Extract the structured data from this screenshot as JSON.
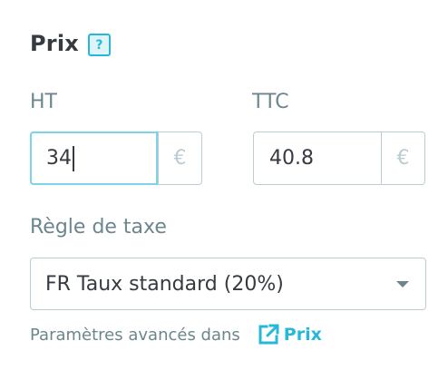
{
  "section": {
    "title": "Prix",
    "help_icon": "help-question-icon",
    "help_glyph": "?"
  },
  "price_excl_tax": {
    "label": "HT",
    "value": "34",
    "currency_symbol": "€",
    "focused": true
  },
  "price_incl_tax": {
    "label": "TTC",
    "value": "40.8",
    "currency_symbol": "€"
  },
  "tax_rule": {
    "label": "Règle de taxe",
    "selected": "FR Taux standard (20%)"
  },
  "advanced": {
    "text": "Paramètres avancés dans",
    "link_label": "Prix",
    "link_icon": "external-link-icon"
  },
  "colors": {
    "accent": "#25b9d7",
    "text": "#363a41",
    "muted": "#6c868e",
    "border": "#bbcdd2",
    "focus": "#7cd5e7"
  }
}
